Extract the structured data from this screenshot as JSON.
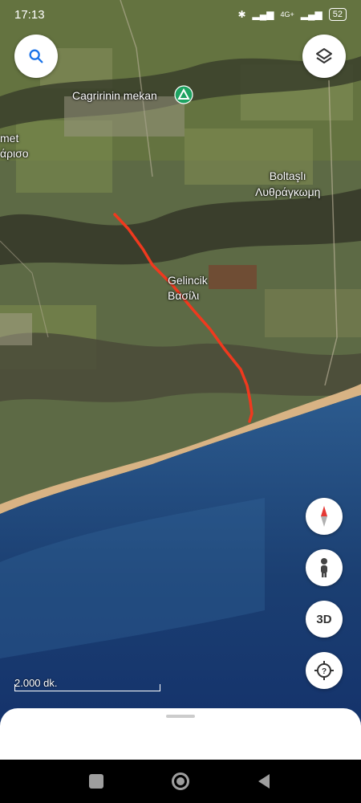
{
  "status_bar": {
    "time": "17:13",
    "network": "4G+",
    "battery": "52"
  },
  "map": {
    "place_labels": [
      {
        "id": "cagri",
        "text": "Cagririnin mekan"
      },
      {
        "id": "met",
        "line1": "met",
        "line2": "άρισο"
      },
      {
        "id": "boltasli",
        "line1": "Boltaşlı",
        "line2": "Λυθράγκωμη"
      },
      {
        "id": "gelincik",
        "line1": "Gelincik",
        "line2": "Βασίλι"
      }
    ],
    "scale_text": "2.000 dk.",
    "route_color": "#f0391e",
    "marker_color": "#1ea362"
  },
  "controls": {
    "zoom3d_label": "3D",
    "icons": [
      "search-icon",
      "layers-icon",
      "compass-icon",
      "pegman-icon",
      "3d-button",
      "location-help-icon"
    ]
  },
  "navigation": {
    "buttons": [
      "recent-apps-button",
      "home-button",
      "back-button"
    ]
  }
}
